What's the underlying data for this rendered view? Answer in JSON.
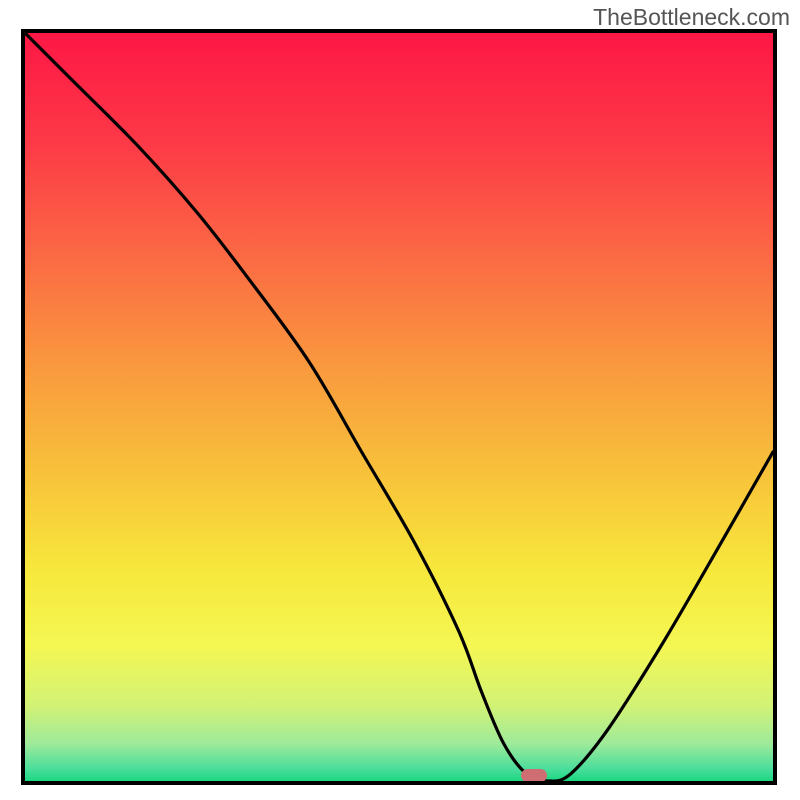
{
  "watermark": "TheBottleneck.com",
  "chart_data": {
    "type": "line",
    "title": "",
    "xlabel": "",
    "ylabel": "",
    "xlim": [
      0,
      100
    ],
    "ylim": [
      0,
      100
    ],
    "x": [
      0,
      6,
      15,
      23,
      30,
      38,
      45,
      52,
      58,
      61,
      64,
      67,
      70,
      73,
      78,
      85,
      92,
      100
    ],
    "y": [
      100,
      94,
      85,
      76,
      67,
      56,
      44,
      32,
      20,
      12,
      5,
      1,
      0,
      1,
      7,
      18,
      30,
      44
    ],
    "marker": {
      "x": 68,
      "y": 0.7,
      "w": 3.5,
      "h": 1.8
    },
    "gradient_stops": [
      {
        "pos": 0.0,
        "color": "#fd1745"
      },
      {
        "pos": 0.15,
        "color": "#fd3a47"
      },
      {
        "pos": 0.3,
        "color": "#fb6a44"
      },
      {
        "pos": 0.45,
        "color": "#f99a3e"
      },
      {
        "pos": 0.6,
        "color": "#f8c53a"
      },
      {
        "pos": 0.72,
        "color": "#f7e83c"
      },
      {
        "pos": 0.82,
        "color": "#f4f753"
      },
      {
        "pos": 0.9,
        "color": "#d2f276"
      },
      {
        "pos": 0.95,
        "color": "#9eea9a"
      },
      {
        "pos": 0.985,
        "color": "#47dd9b"
      },
      {
        "pos": 1.0,
        "color": "#1bd77f"
      }
    ]
  },
  "plot": {
    "inner_w": 748,
    "inner_h": 748
  }
}
